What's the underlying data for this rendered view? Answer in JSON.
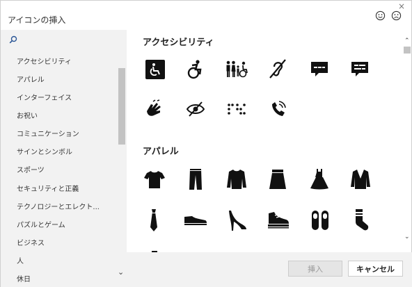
{
  "dialog": {
    "title": "アイコンの挿入",
    "close_icon": "×",
    "feedback_positive_icon": "smile-icon",
    "feedback_negative_icon": "frown-icon"
  },
  "sidebar": {
    "search_placeholder": "",
    "categories": [
      "アクセシビリティ",
      "アパレル",
      "インターフェイス",
      "お祝い",
      "コミュニケーション",
      "サインとシンボル",
      "スポーツ",
      "セキュリティと正義",
      "テクノロジーとエレクト...",
      "パズルとゲーム",
      "ビジネス",
      "人",
      "休日"
    ]
  },
  "sections": {
    "accessibility": {
      "title": "アクセシビリティ",
      "icons": [
        "accessible-icon",
        "active-wheelchair-icon",
        "family-access-icon",
        "hearing-impaired-icon",
        "closed-caption-icon",
        "subtitles-icon",
        "sign-language-icon",
        "low-vision-icon",
        "braille-icon",
        "volume-phone-icon"
      ]
    },
    "apparel": {
      "title": "アパレル",
      "icons": [
        "tshirt-icon",
        "pants-icon",
        "sweater-icon",
        "skirt-icon",
        "dress-icon",
        "jacket-icon",
        "tie-icon",
        "shoe-icon",
        "high-heel-icon",
        "sneaker-icon",
        "slippers-icon",
        "sock-icon"
      ]
    }
  },
  "footer": {
    "insert_label": "挿入",
    "cancel_label": "キャンセル"
  }
}
